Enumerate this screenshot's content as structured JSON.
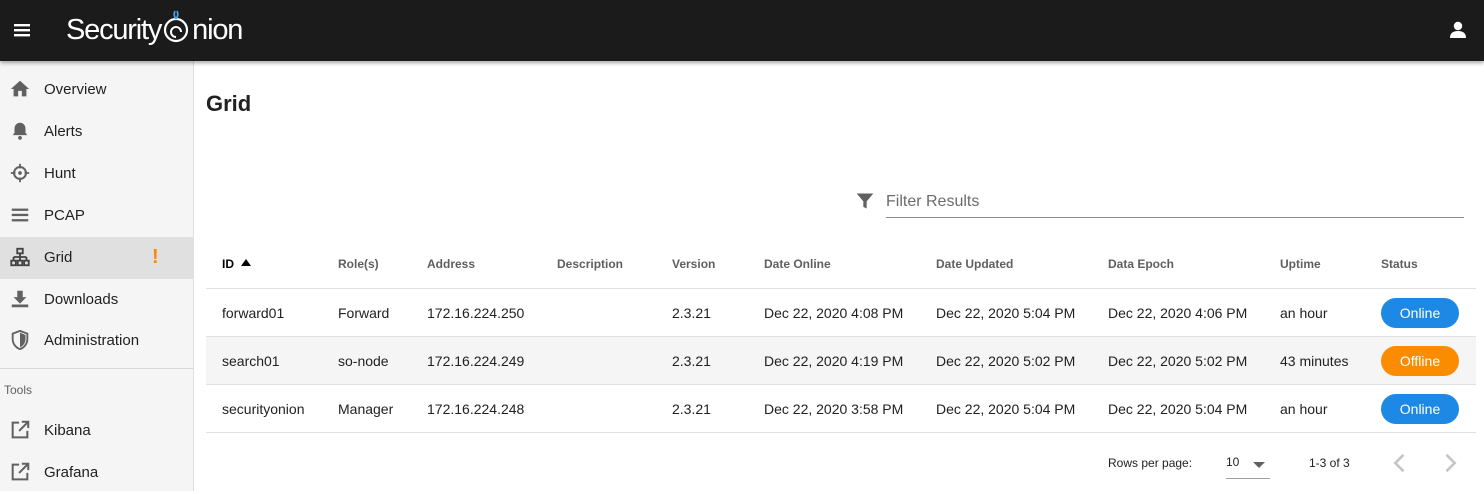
{
  "app": {
    "logo_left": "Security",
    "logo_right": "nion"
  },
  "colors": {
    "topbar": "#1b1b1b",
    "online": "#1e88e5",
    "offline": "#fb8c00",
    "alert": "#fb8c00"
  },
  "sidebar": {
    "items": [
      {
        "label": "Overview",
        "icon": "home-icon"
      },
      {
        "label": "Alerts",
        "icon": "bell-icon"
      },
      {
        "label": "Hunt",
        "icon": "crosshairs-icon"
      },
      {
        "label": "PCAP",
        "icon": "list-lines-icon"
      },
      {
        "label": "Grid",
        "icon": "sitemap-icon",
        "active": true,
        "alert": "!"
      },
      {
        "label": "Downloads",
        "icon": "download-icon"
      },
      {
        "label": "Administration",
        "icon": "shield-icon"
      }
    ],
    "tools_header": "Tools",
    "tools": [
      {
        "label": "Kibana",
        "icon": "external-link-icon"
      },
      {
        "label": "Grafana",
        "icon": "external-link-icon"
      }
    ]
  },
  "main": {
    "title": "Grid",
    "filter": {
      "placeholder": "Filter Results",
      "value": ""
    },
    "table": {
      "columns": [
        "ID",
        "Role(s)",
        "Address",
        "Description",
        "Version",
        "Date Online",
        "Date Updated",
        "Data Epoch",
        "Uptime",
        "Status"
      ],
      "sorted_by": "ID",
      "rows": [
        {
          "id": "forward01",
          "role": "Forward",
          "address": "172.16.224.250",
          "description": "",
          "version": "2.3.21",
          "date_online": "Dec 22, 2020 4:08 PM",
          "date_updated": "Dec 22, 2020 5:04 PM",
          "data_epoch": "Dec 22, 2020 4:06 PM",
          "uptime": "an hour",
          "status": "Online"
        },
        {
          "id": "search01",
          "role": "so-node",
          "address": "172.16.224.249",
          "description": "",
          "version": "2.3.21",
          "date_online": "Dec 22, 2020 4:19 PM",
          "date_updated": "Dec 22, 2020 5:02 PM",
          "data_epoch": "Dec 22, 2020 5:02 PM",
          "uptime": "43 minutes",
          "status": "Offline"
        },
        {
          "id": "securityonion",
          "role": "Manager",
          "address": "172.16.224.248",
          "description": "",
          "version": "2.3.21",
          "date_online": "Dec 22, 2020 3:58 PM",
          "date_updated": "Dec 22, 2020 5:04 PM",
          "data_epoch": "Dec 22, 2020 5:04 PM",
          "uptime": "an hour",
          "status": "Online"
        }
      ]
    },
    "pagination": {
      "rows_per_page_label": "Rows per page:",
      "rows_per_page": "10",
      "range": "1-3 of 3"
    }
  }
}
